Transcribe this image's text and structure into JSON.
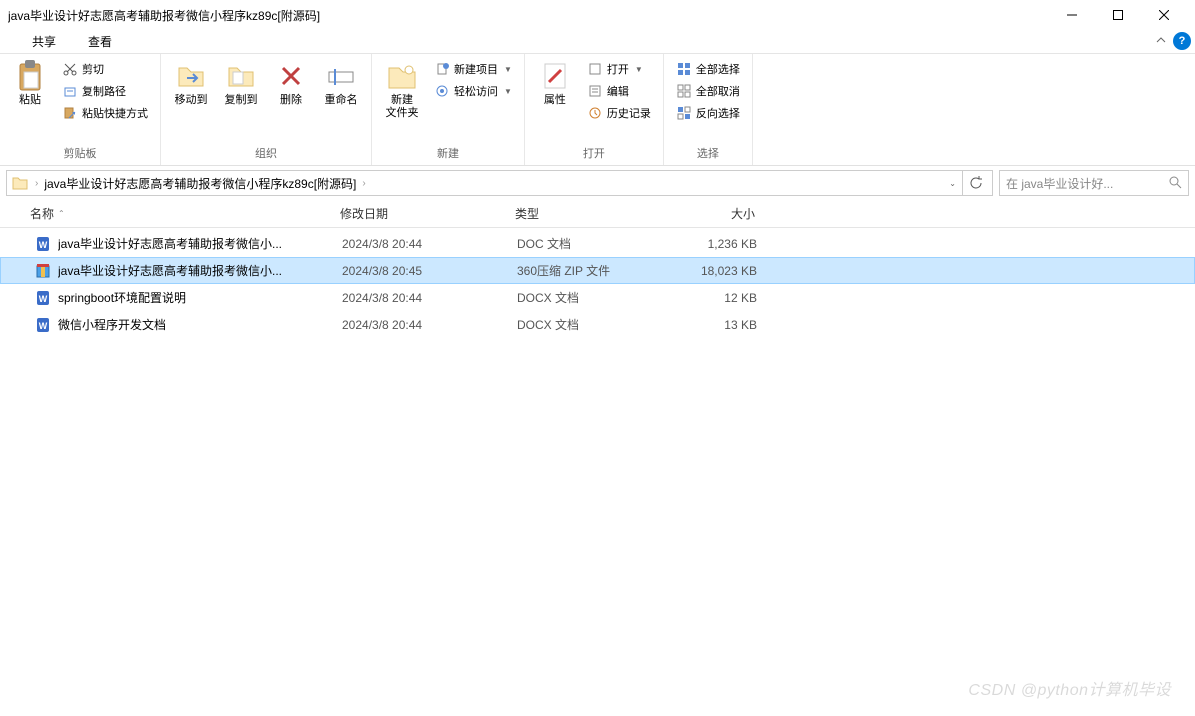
{
  "window": {
    "title": "java毕业设计好志愿高考辅助报考微信小程序kz89c[附源码]"
  },
  "menu": {
    "share": "共享",
    "view": "查看"
  },
  "ribbon": {
    "clipboard": {
      "label": "剪贴板",
      "paste": "粘贴",
      "cut": "剪切",
      "copypath": "复制路径",
      "pasteshortcut": "粘贴快捷方式"
    },
    "organize": {
      "label": "组织",
      "moveto": "移动到",
      "copyto": "复制到",
      "delete": "删除",
      "rename": "重命名"
    },
    "new": {
      "label": "新建",
      "newfolder": "新建\n文件夹",
      "newitem": "新建项目",
      "easyaccess": "轻松访问"
    },
    "open": {
      "label": "打开",
      "properties": "属性",
      "open": "打开",
      "edit": "编辑",
      "history": "历史记录"
    },
    "select": {
      "label": "选择",
      "selectall": "全部选择",
      "selectnone": "全部取消",
      "invert": "反向选择"
    }
  },
  "address": {
    "path": "java毕业设计好志愿高考辅助报考微信小程序kz89c[附源码]"
  },
  "search": {
    "placeholder": "在 java毕业设计好..."
  },
  "columns": {
    "name": "名称",
    "date": "修改日期",
    "type": "类型",
    "size": "大小"
  },
  "files": [
    {
      "icon": "doc",
      "name": "java毕业设计好志愿高考辅助报考微信小...",
      "date": "2024/3/8 20:44",
      "type": "DOC 文档",
      "size": "1,236 KB",
      "selected": false
    },
    {
      "icon": "zip",
      "name": "java毕业设计好志愿高考辅助报考微信小...",
      "date": "2024/3/8 20:45",
      "type": "360压缩 ZIP 文件",
      "size": "18,023 KB",
      "selected": true
    },
    {
      "icon": "docx",
      "name": "springboot环境配置说明",
      "date": "2024/3/8 20:44",
      "type": "DOCX 文档",
      "size": "12 KB",
      "selected": false
    },
    {
      "icon": "docx",
      "name": "微信小程序开发文档",
      "date": "2024/3/8 20:44",
      "type": "DOCX 文档",
      "size": "13 KB",
      "selected": false
    }
  ],
  "watermark": "CSDN @python计算机毕设"
}
